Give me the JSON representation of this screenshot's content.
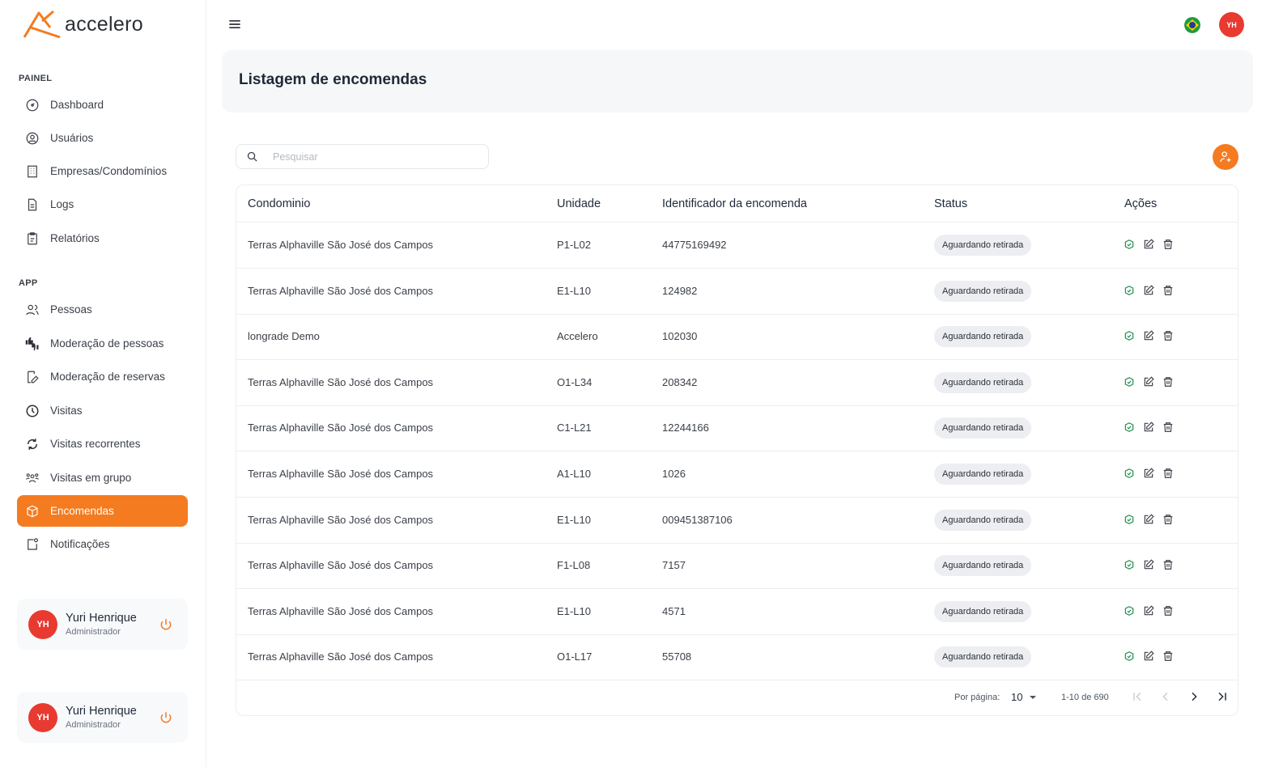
{
  "brand": {
    "name": "accelero",
    "accent": "#f47b20"
  },
  "sidebar": {
    "sections": [
      {
        "label": "PAINEL",
        "items": [
          {
            "label": "Dashboard",
            "icon": "dashboard-icon"
          },
          {
            "label": "Usuários",
            "icon": "user-circle-icon"
          },
          {
            "label": "Empresas/Condomínios",
            "icon": "building-icon"
          },
          {
            "label": "Logs",
            "icon": "file-icon"
          },
          {
            "label": "Relatórios",
            "icon": "clipboard-icon"
          }
        ]
      },
      {
        "label": "APP",
        "items": [
          {
            "label": "Pessoas",
            "icon": "users-icon"
          },
          {
            "label": "Moderação de pessoas",
            "icon": "thumbs-icon"
          },
          {
            "label": "Moderação de reservas",
            "icon": "calendar-edit-icon"
          },
          {
            "label": "Visitas",
            "icon": "clock-icon"
          },
          {
            "label": "Visitas recorrentes",
            "icon": "refresh-icon"
          },
          {
            "label": "Visitas em grupo",
            "icon": "group-icon"
          },
          {
            "label": "Encomendas",
            "icon": "package-icon",
            "active": true
          },
          {
            "label": "Notificações",
            "icon": "bell-icon"
          }
        ]
      }
    ],
    "user_cards": [
      {
        "initials": "YH",
        "name": "Yuri Henrique",
        "role": "Administrador"
      },
      {
        "initials": "YH",
        "name": "Yuri Henrique",
        "role": "Administrador"
      }
    ]
  },
  "header": {
    "avatar_initials": "YH"
  },
  "page": {
    "title": "Listagem de encomendas"
  },
  "search": {
    "placeholder": "Pesquisar",
    "value": ""
  },
  "table": {
    "columns": [
      "Condominio",
      "Unidade",
      "Identificador da encomenda",
      "Status",
      "Ações"
    ],
    "rows": [
      {
        "condominio": "Terras Alphaville São José dos Campos",
        "unidade": "P1-L02",
        "id": "44775169492",
        "status": "Aguardando retirada"
      },
      {
        "condominio": "Terras Alphaville São José dos Campos",
        "unidade": "E1-L10",
        "id": "124982",
        "status": "Aguardando retirada"
      },
      {
        "condominio": "longrade Demo",
        "unidade": "Accelero",
        "id": "102030",
        "status": "Aguardando retirada"
      },
      {
        "condominio": "Terras Alphaville São José dos Campos",
        "unidade": "O1-L34",
        "id": "208342",
        "status": "Aguardando retirada"
      },
      {
        "condominio": "Terras Alphaville São José dos Campos",
        "unidade": "C1-L21",
        "id": "12244166",
        "status": "Aguardando retirada"
      },
      {
        "condominio": "Terras Alphaville São José dos Campos",
        "unidade": "A1-L10",
        "id": "1026",
        "status": "Aguardando retirada"
      },
      {
        "condominio": "Terras Alphaville São José dos Campos",
        "unidade": "E1-L10",
        "id": "009451387106",
        "status": "Aguardando retirada"
      },
      {
        "condominio": "Terras Alphaville São José dos Campos",
        "unidade": "F1-L08",
        "id": "7157",
        "status": "Aguardando retirada"
      },
      {
        "condominio": "Terras Alphaville São José dos Campos",
        "unidade": "E1-L10",
        "id": "4571",
        "status": "Aguardando retirada"
      },
      {
        "condominio": "Terras Alphaville São José dos Campos",
        "unidade": "O1-L17",
        "id": "55708",
        "status": "Aguardando retirada"
      }
    ]
  },
  "pagination": {
    "per_page_label": "Por página:",
    "per_page": "10",
    "range": "1-10 de 690"
  },
  "colors": {
    "accent": "#f47b20",
    "avatar": "#e83a30",
    "badge": "#eceef1",
    "check": "#1a8a4a"
  }
}
